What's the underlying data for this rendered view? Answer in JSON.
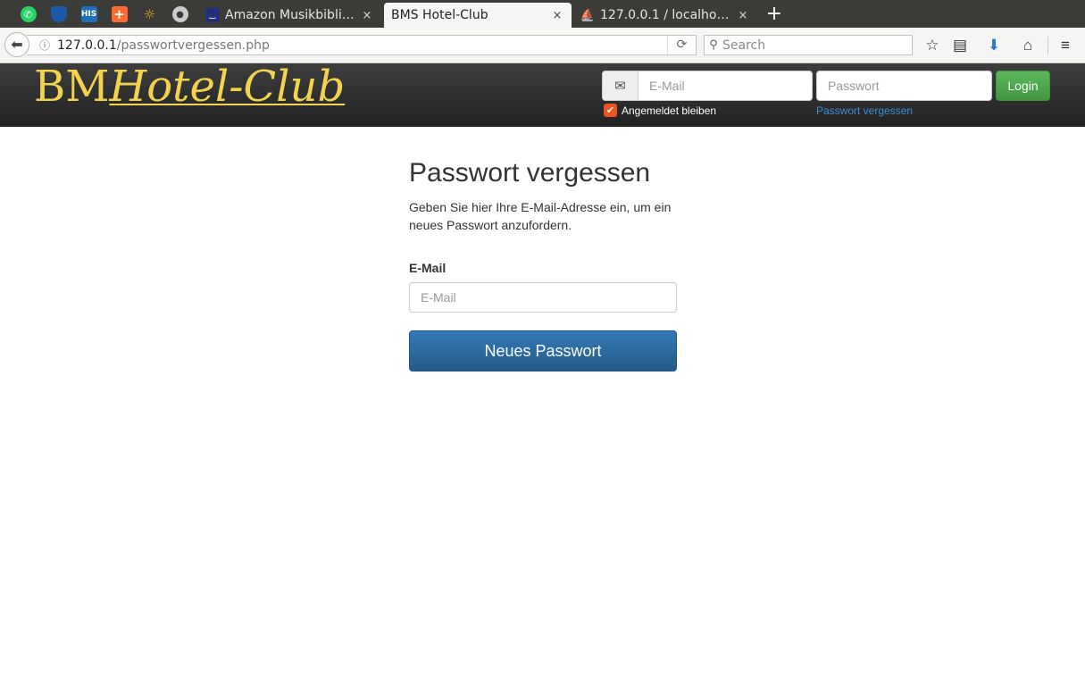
{
  "browser": {
    "pinned_tabs": [
      {
        "icon": "whatsapp-icon",
        "color": "#25d366"
      },
      {
        "icon": "shield-icon",
        "color": "#1c5aa8"
      },
      {
        "icon": "his-icon",
        "color": "#1e6fb8"
      },
      {
        "icon": "swiss-cross-icon",
        "color": "#ff6a2e"
      },
      {
        "icon": "lightbulb-icon",
        "color": "#e8b325"
      },
      {
        "icon": "github-icon",
        "color": "#cccccc"
      }
    ],
    "tabs": [
      {
        "title": "Amazon Musikbiblio...",
        "active": false
      },
      {
        "title": "BMS Hotel-Club",
        "active": true
      },
      {
        "title": "127.0.0.1 / localhost...",
        "active": false
      }
    ],
    "close_glyph": "×",
    "new_tab_glyph": "+",
    "url": {
      "host": "127.0.0.1",
      "path": "/passwortvergessen.php"
    },
    "search_placeholder": "Search"
  },
  "site": {
    "brand_prefix": "BM",
    "brand_name": "Hotel-Club",
    "brand_color": "#f3d34e",
    "login": {
      "email_placeholder": "E-Mail",
      "password_placeholder": "Passwort",
      "button_label": "Login",
      "remember_label": "Angemeldet bleiben",
      "forgot_label": "Passwort vergessen"
    }
  },
  "page": {
    "heading": "Passwort vergessen",
    "intro": "Geben Sie hier Ihre E-Mail-Adresse ein, um ein neues Passwort anzufordern.",
    "email_label": "E-Mail",
    "email_placeholder": "E-Mail",
    "submit_label": "Neues Passwort"
  }
}
